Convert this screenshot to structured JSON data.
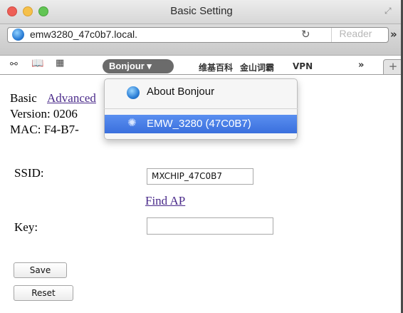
{
  "window": {
    "title": "Basic Setting"
  },
  "toolbar": {
    "url": "emw3280_47c0b7.local.",
    "reader_label": "Reader",
    "overflow_label": "»"
  },
  "bookmarks": {
    "bonjour_label": "Bonjour ▾",
    "items": [
      "维基百科",
      "金山词霸",
      "VPN"
    ],
    "more_label": "»",
    "newtab_label": "+"
  },
  "bonjour_menu": {
    "about_label": "About Bonjour",
    "device_label": "EMW_3280 (47C0B7)"
  },
  "page": {
    "nav_basic": "Basic",
    "nav_advanced": "Advanced",
    "version_text": "Version: 0206",
    "mac_text": "MAC: F4-B7-",
    "ssid_label": "SSID:",
    "ssid_value": "MXCHIP_47C0B7",
    "find_ap_label": "Find AP",
    "key_label": "Key:",
    "key_value": "",
    "save_label": "Save",
    "reset_label": "Reset"
  }
}
